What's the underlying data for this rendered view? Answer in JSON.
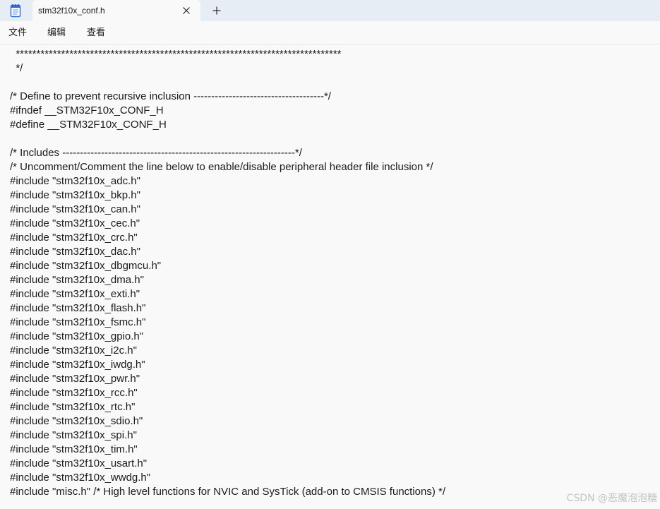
{
  "window": {
    "tab_title": "stm32f10x_conf.h",
    "app_icon": "notepad-icon",
    "close_icon": "close-icon",
    "new_tab_icon": "plus-icon"
  },
  "menu": {
    "file": "文件",
    "edit": "编辑",
    "view": "查看"
  },
  "editor": {
    "lines": [
      "  *******************************************************************************",
      "  */",
      "",
      "/* Define to prevent recursive inclusion -------------------------------------*/",
      "#ifndef __STM32F10x_CONF_H",
      "#define __STM32F10x_CONF_H",
      "",
      "/* Includes ------------------------------------------------------------------*/",
      "/* Uncomment/Comment the line below to enable/disable peripheral header file inclusion */",
      "#include \"stm32f10x_adc.h\"",
      "#include \"stm32f10x_bkp.h\"",
      "#include \"stm32f10x_can.h\"",
      "#include \"stm32f10x_cec.h\"",
      "#include \"stm32f10x_crc.h\"",
      "#include \"stm32f10x_dac.h\"",
      "#include \"stm32f10x_dbgmcu.h\"",
      "#include \"stm32f10x_dma.h\"",
      "#include \"stm32f10x_exti.h\"",
      "#include \"stm32f10x_flash.h\"",
      "#include \"stm32f10x_fsmc.h\"",
      "#include \"stm32f10x_gpio.h\"",
      "#include \"stm32f10x_i2c.h\"",
      "#include \"stm32f10x_iwdg.h\"",
      "#include \"stm32f10x_pwr.h\"",
      "#include \"stm32f10x_rcc.h\"",
      "#include \"stm32f10x_rtc.h\"",
      "#include \"stm32f10x_sdio.h\"",
      "#include \"stm32f10x_spi.h\"",
      "#include \"stm32f10x_tim.h\"",
      "#include \"stm32f10x_usart.h\"",
      "#include \"stm32f10x_wwdg.h\"",
      "#include \"misc.h\" /* High level functions for NVIC and SysTick (add-on to CMSIS functions) */"
    ]
  },
  "watermark": "CSDN @恶魔泡泡糖",
  "colors": {
    "tabbar_bg": "#e6edf4",
    "editor_bg": "#f9f9f9",
    "text": "#1a1a1a",
    "icon_accent": "#2f6fd6"
  }
}
